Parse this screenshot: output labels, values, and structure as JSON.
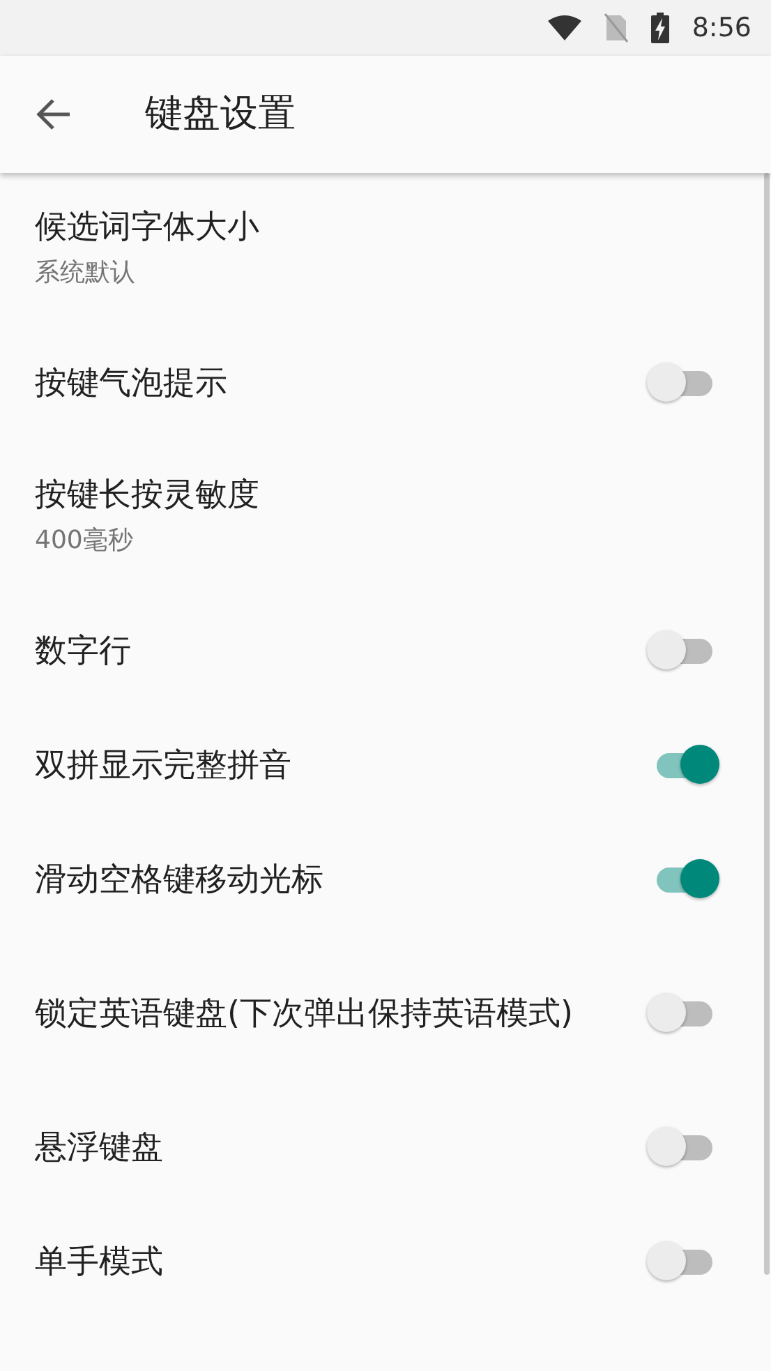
{
  "status_bar": {
    "time": "8:56"
  },
  "app_bar": {
    "title": "键盘设置"
  },
  "settings": [
    {
      "kind": "value",
      "title": "候选词字体大小",
      "summary": "系统默认"
    },
    {
      "kind": "switch",
      "title": "按键气泡提示",
      "on": false
    },
    {
      "kind": "value",
      "title": "按键长按灵敏度",
      "summary": "400毫秒"
    },
    {
      "kind": "switch",
      "title": "数字行",
      "on": false
    },
    {
      "kind": "switch",
      "title": "双拼显示完整拼音",
      "on": true
    },
    {
      "kind": "switch",
      "title": "滑动空格键移动光标",
      "on": true
    },
    {
      "kind": "switch",
      "title": "锁定英语键盘(下次弹出保持英语模式)",
      "on": false
    },
    {
      "kind": "switch",
      "title": "悬浮键盘",
      "on": false
    },
    {
      "kind": "switch",
      "title": "单手模式",
      "on": false
    }
  ]
}
